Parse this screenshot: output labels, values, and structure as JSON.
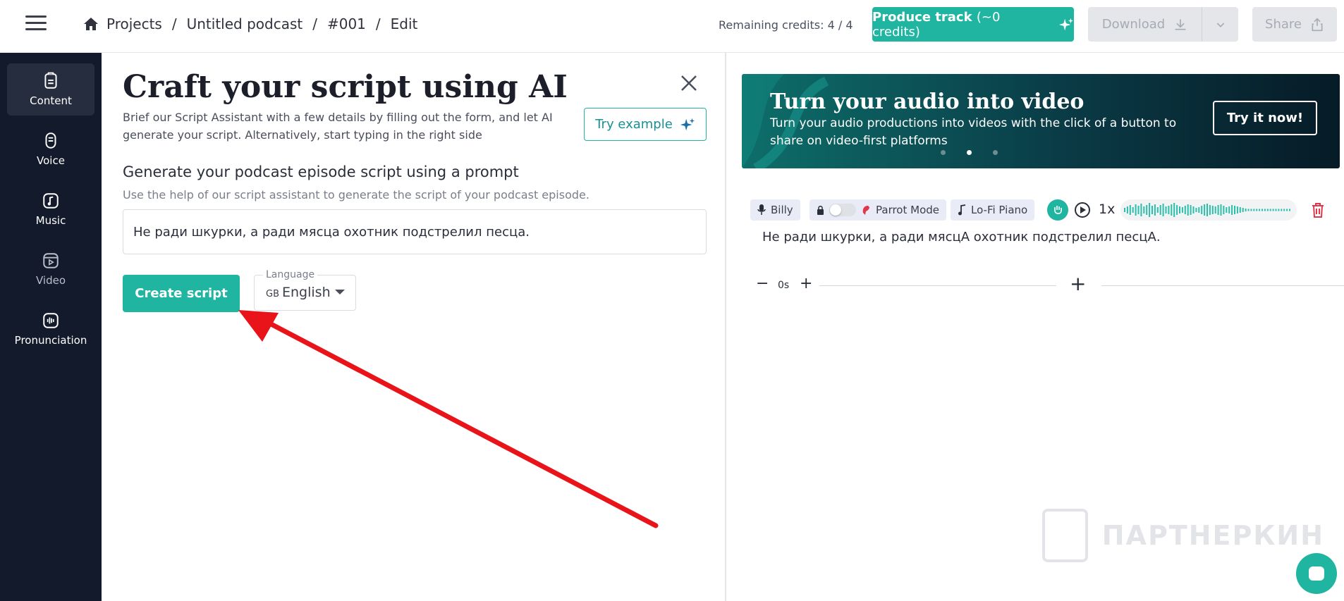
{
  "header": {
    "breadcrumb": [
      "Projects",
      "Untitled podcast",
      "#001",
      "Edit"
    ],
    "separator": "/",
    "credits": "Remaining credits: 4 / 4",
    "produce_label": "Produce track",
    "produce_credits": "(~0 credits)",
    "download_label": "Download",
    "share_label": "Share"
  },
  "sidebar": {
    "items": [
      {
        "label": "Content",
        "icon": "content-icon",
        "active": true
      },
      {
        "label": "Voice",
        "icon": "microphone-icon",
        "active": false
      },
      {
        "label": "Music",
        "icon": "music-note-icon",
        "active": false
      },
      {
        "label": "Video",
        "icon": "video-icon",
        "active": false
      },
      {
        "label": "Pronunciation",
        "icon": "waveform-icon",
        "active": false
      }
    ]
  },
  "script_panel": {
    "title": "Craft your script using AI",
    "description": "Brief our Script Assistant with a few details by filling out the form, and let AI generate your script. Alternatively, start typing in the right side",
    "try_example_label": "Try example",
    "section_heading": "Generate your podcast episode script using a prompt",
    "section_subtext": "Use the help of our script assistant to generate the script of your podcast episode.",
    "prompt_value": "Не ради шкурки, а ради мясца охотник подстрелил песца.",
    "create_label": "Create script",
    "language_label": "Language",
    "language_flag": "GB",
    "language_value": "English"
  },
  "banner": {
    "title": "Turn your audio into video",
    "text": "Turn your audio productions into videos with the click of a button to share on video-first platforms",
    "button_label": "Try it now!",
    "active_dot": 1
  },
  "track": {
    "voice": "Billy",
    "parrot_label": "Parrot Mode",
    "music": "Lo-Fi Piano",
    "speed": "1x",
    "text": "Не ради шкурки, а ради мясцА охотник подстрелил песцА."
  },
  "timeline": {
    "pause_value": "0s"
  },
  "watermark": {
    "text": "ПАРТНЕРКИН"
  },
  "colors": {
    "accent": "#1fb5a1",
    "sidebar_bg": "#131a2c",
    "arrow": "#e8141a"
  }
}
